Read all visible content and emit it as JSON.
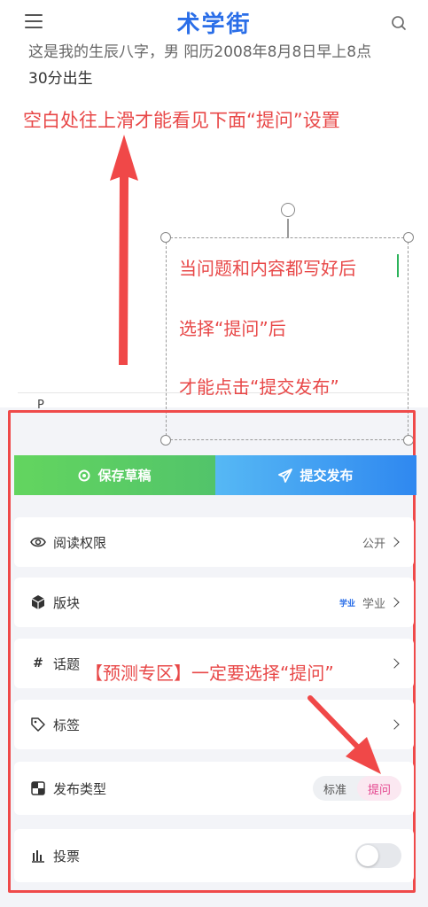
{
  "app": {
    "title": "术学街"
  },
  "article": {
    "line_cut": "这是我的生辰八字，男 阳历2008年8月8日早上8点",
    "line_second": "30分出生",
    "editor_placeholder": "P"
  },
  "annotations": {
    "top": "空白处往上滑才能看见下面“提问”设置",
    "box_line1": "当问题和内容都写好后",
    "box_line2": "选择“提问”后",
    "box_line3": "才能点击“提交发布”",
    "middle": "【预测专区】一定要选择“提问”",
    "color": "#e84848"
  },
  "actions": {
    "save_label": "保存草稿",
    "submit_label": "提交发布"
  },
  "settings": {
    "read_permission": {
      "label": "阅读权限",
      "value": "公开"
    },
    "section": {
      "label": "版块",
      "tag": "学业",
      "value": "学业"
    },
    "topic": {
      "label": "话题"
    },
    "tags": {
      "label": "标签"
    },
    "post_type": {
      "label": "发布类型",
      "option_standard": "标准",
      "option_question": "提问",
      "selected": "提问"
    },
    "vote": {
      "label": "投票",
      "enabled": false
    }
  }
}
